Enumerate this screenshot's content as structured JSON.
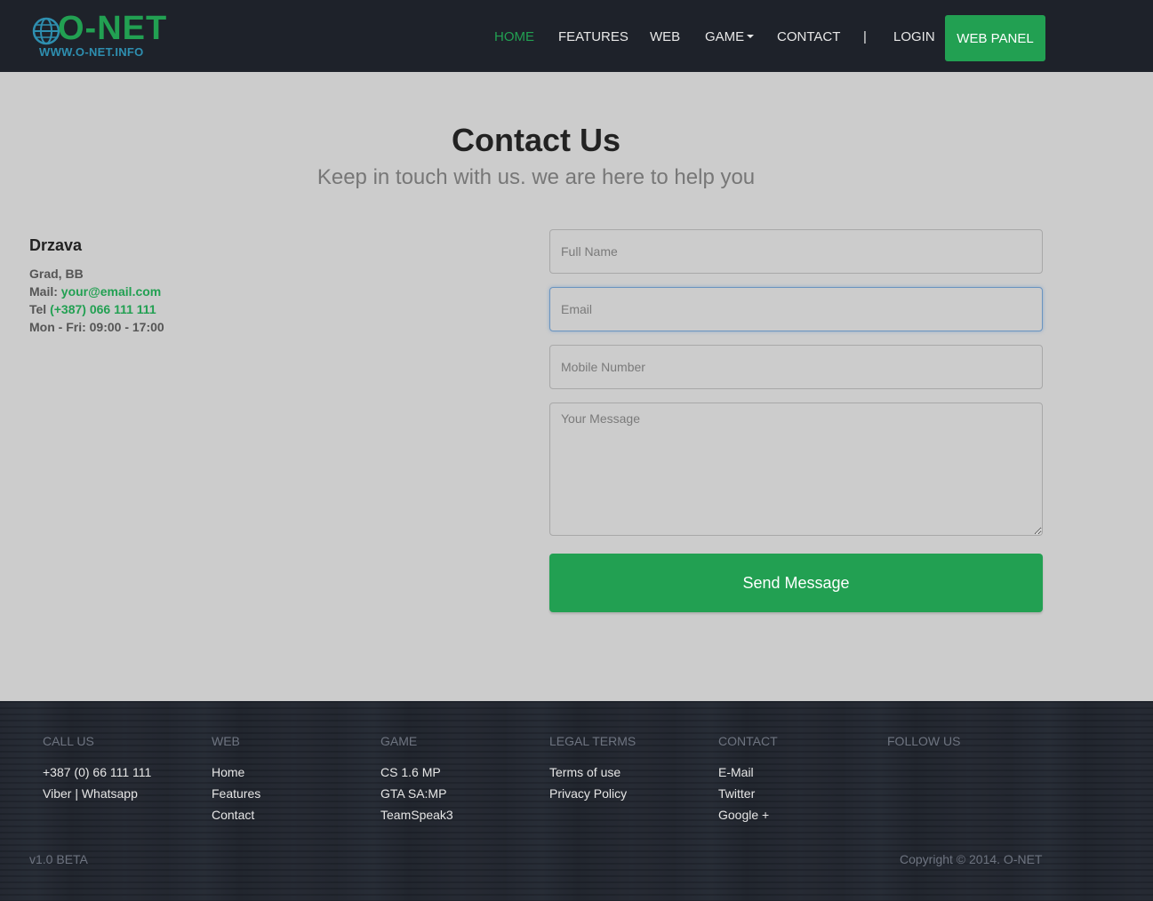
{
  "brand": {
    "logo_text": "O-NET",
    "logo_sub": "WWW.O-NET.INFO",
    "accent": "#22a052"
  },
  "nav": {
    "home": "HOME",
    "features": "FEATURES",
    "web": "WEB",
    "game": "GAME",
    "contact": "CONTACT",
    "separator": "|",
    "login": "LOGIN",
    "web_panel": "WEB PANEL"
  },
  "hero": {
    "title": "Contact Us",
    "subtitle": "Keep in touch with us. we are here to help you"
  },
  "info": {
    "title": "Drzava",
    "city": "Grad, BB",
    "mail_label": "Mail:",
    "mail_value": "your@email.com",
    "tel_label": "Tel",
    "tel_value": "(+387) 066 111 111",
    "hours": "Mon - Fri: 09:00 - 17:00"
  },
  "form": {
    "name_placeholder": "Full Name",
    "email_placeholder": "Email",
    "mobile_placeholder": "Mobile Number",
    "message_placeholder": "Your Message",
    "send_label": "Send Message"
  },
  "footer": {
    "call": {
      "heading": "CALL US",
      "links": [
        "+387 (0) 66 111 111",
        "Viber | Whatsapp"
      ]
    },
    "web": {
      "heading": "WEB",
      "links": [
        "Home",
        "Features",
        "Contact"
      ]
    },
    "game": {
      "heading": "GAME",
      "links": [
        "CS 1.6 MP",
        "GTA SA:MP",
        "TeamSpeak3"
      ]
    },
    "legal": {
      "heading": "LEGAL TERMS",
      "links": [
        "Terms of use",
        "Privacy Policy"
      ]
    },
    "contact": {
      "heading": "CONTACT",
      "links": [
        "E-Mail",
        "Twitter",
        "Google +"
      ]
    },
    "follow": {
      "heading": "FOLLOW US"
    },
    "version": "v1.0 BETA",
    "copyright": "Copyright © 2014. O-NET"
  }
}
